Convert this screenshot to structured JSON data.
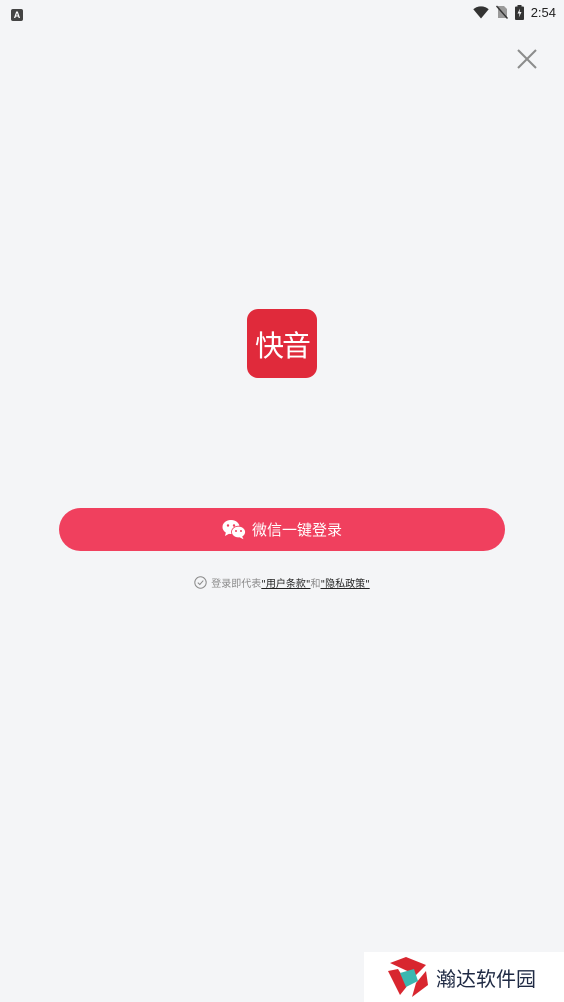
{
  "status_bar": {
    "left_icon": "a-icon",
    "left_icon_glyph": "A",
    "icons": [
      "wifi-icon",
      "no-sim-icon",
      "battery-charging-icon"
    ],
    "time": "2:54"
  },
  "close": {
    "icon": "close-icon"
  },
  "logo": {
    "text": "快音",
    "color": "#e02a3b"
  },
  "login": {
    "wechat_label": "微信一键登录",
    "icon": "wechat-icon",
    "color": "#f0405e"
  },
  "agreement": {
    "prefix": "登录即代表",
    "terms": "\"用户条款\"",
    "and": "和",
    "privacy": "\"隐私政策\"",
    "checked": false
  },
  "watermark": {
    "text": "瀚达软件园"
  }
}
